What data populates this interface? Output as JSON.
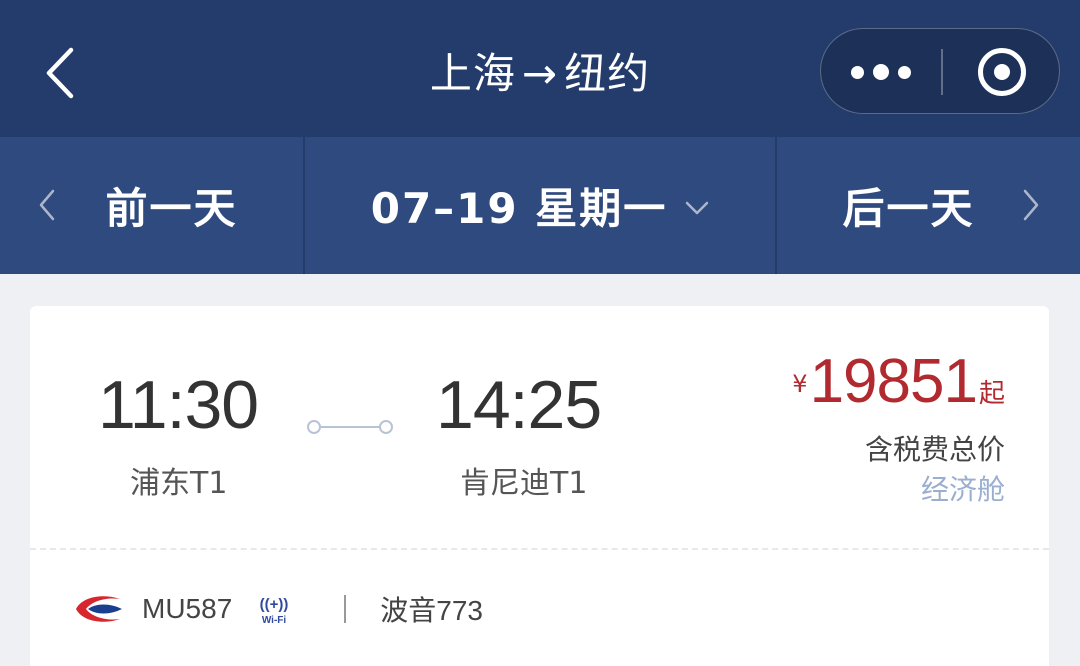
{
  "header": {
    "title_from": "上海",
    "title_arrow": "→",
    "title_to": "纽约"
  },
  "capsule": {
    "more_icon": "more-dots-icon",
    "close_icon": "record-target-icon"
  },
  "date_nav": {
    "prev_label": "前一天",
    "current_label": "07–19 星期一",
    "next_label": "后一天"
  },
  "flight": {
    "departure_time": "11:30",
    "departure_airport": "浦东T1",
    "arrival_time": "14:25",
    "arrival_airport": "肯尼迪T1",
    "currency_symbol": "¥",
    "price": "19851",
    "price_suffix": "起",
    "tax_note": "含税费总价",
    "cabin": "经济舱",
    "flight_number": "MU587",
    "aircraft": "波音773",
    "wifi_text": "Wi-Fi",
    "wifi_symbol": "((+))"
  },
  "colors": {
    "nav_bg": "#243c6c",
    "datebar_bg": "#2f4a7e",
    "price_red": "#b02a30",
    "cabin_blue": "#9aaed0",
    "airline_red": "#d8262f",
    "airline_blue": "#1b3f8f"
  }
}
